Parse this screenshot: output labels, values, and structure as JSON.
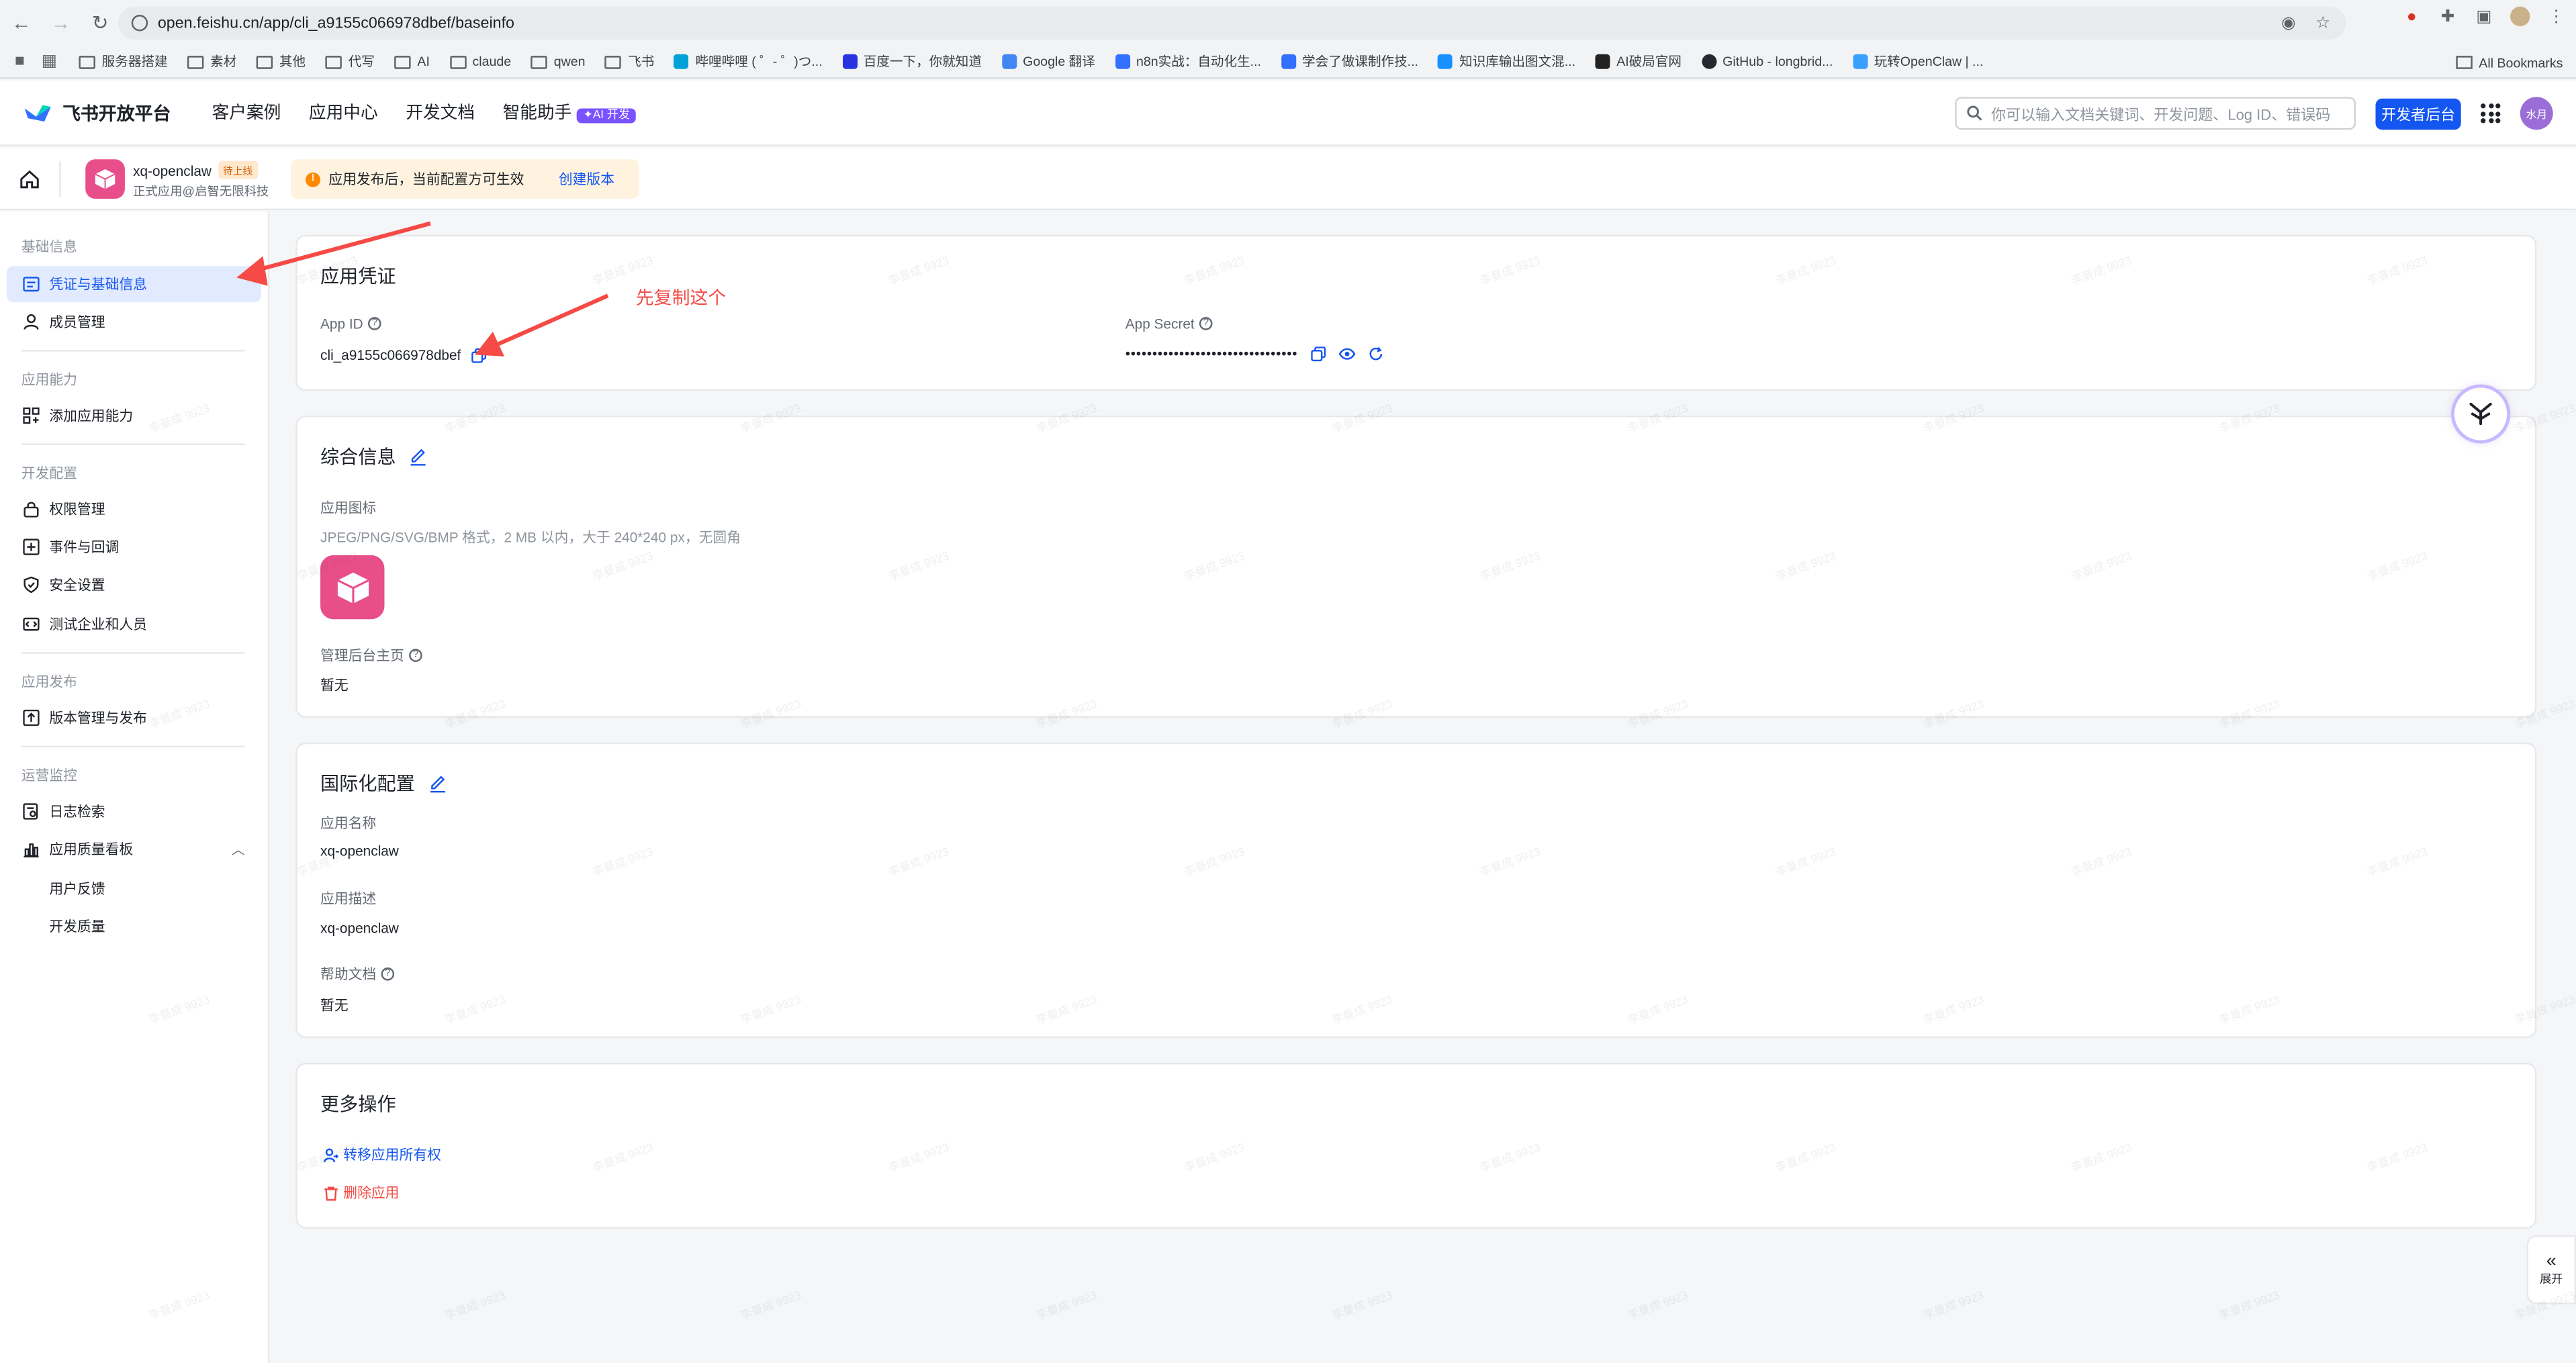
{
  "browser": {
    "url": "open.feishu.cn/app/cli_a9155c066978dbef/baseinfo",
    "bookmarks": [
      "服务器搭建",
      "素材",
      "其他",
      "代写",
      "AI",
      "claude",
      "qwen",
      "飞书",
      "哔哩哔哩 ( ゜- ゜)つ...",
      "百度一下，你就知道",
      "Google 翻译",
      "n8n实战：自动化生...",
      "学会了做课制作技...",
      "知识库输出图文混...",
      "AI破局官网",
      "GitHub - longbrid...",
      "玩转OpenClaw | ..."
    ],
    "all_bookmarks": "All Bookmarks"
  },
  "header": {
    "logo": "飞书开放平台",
    "nav": [
      "客户案例",
      "应用中心",
      "开发文档",
      "智能助手"
    ],
    "ai_badge": "AI 开发",
    "search_placeholder": "你可以输入文档关键词、开发问题、Log ID、错误码",
    "dev_console": "开发者后台",
    "avatar_text": "水月"
  },
  "appbar": {
    "app_name": "xq-openclaw",
    "status_tag": "待上线",
    "subtitle": "正式应用@启智无限科技",
    "notice": "应用发布后，当前配置方可生效",
    "notice_link": "创建版本"
  },
  "sidebar": {
    "groups": [
      "基础信息",
      "应用能力",
      "开发配置",
      "应用发布",
      "运营监控"
    ],
    "items": [
      "凭证与基础信息",
      "成员管理",
      "添加应用能力",
      "权限管理",
      "事件与回调",
      "安全设置",
      "测试企业和人员",
      "版本管理与发布",
      "日志检索",
      "应用质量看板",
      "用户反馈",
      "开发质量"
    ]
  },
  "credentials": {
    "title": "应用凭证",
    "app_id_label": "App ID",
    "app_id": "cli_a9155c066978dbef",
    "secret_label": "App Secret",
    "secret_masked": "••••••••••••••••••••••••••••••••",
    "annotation": "先复制这个"
  },
  "general": {
    "title": "综合信息",
    "icon_label": "应用图标",
    "icon_hint": "JPEG/PNG/SVG/BMP 格式，2 MB 以内，大于 240*240 px，无圆角",
    "admin_home_label": "管理后台主页",
    "admin_home_value": "暂无"
  },
  "i18n": {
    "title": "国际化配置",
    "name_label": "应用名称",
    "name_value": "xq-openclaw",
    "desc_label": "应用描述",
    "desc_value": "xq-openclaw",
    "help_label": "帮助文档",
    "help_value": "暂无"
  },
  "more": {
    "title": "更多操作",
    "transfer": "转移应用所有权",
    "delete": "删除应用"
  },
  "expand_label": "展开",
  "watermark": "李曼成 9923",
  "colors": {
    "accent": "#1456f0",
    "danger": "#f54a45",
    "app_icon": "#e84f8a"
  }
}
